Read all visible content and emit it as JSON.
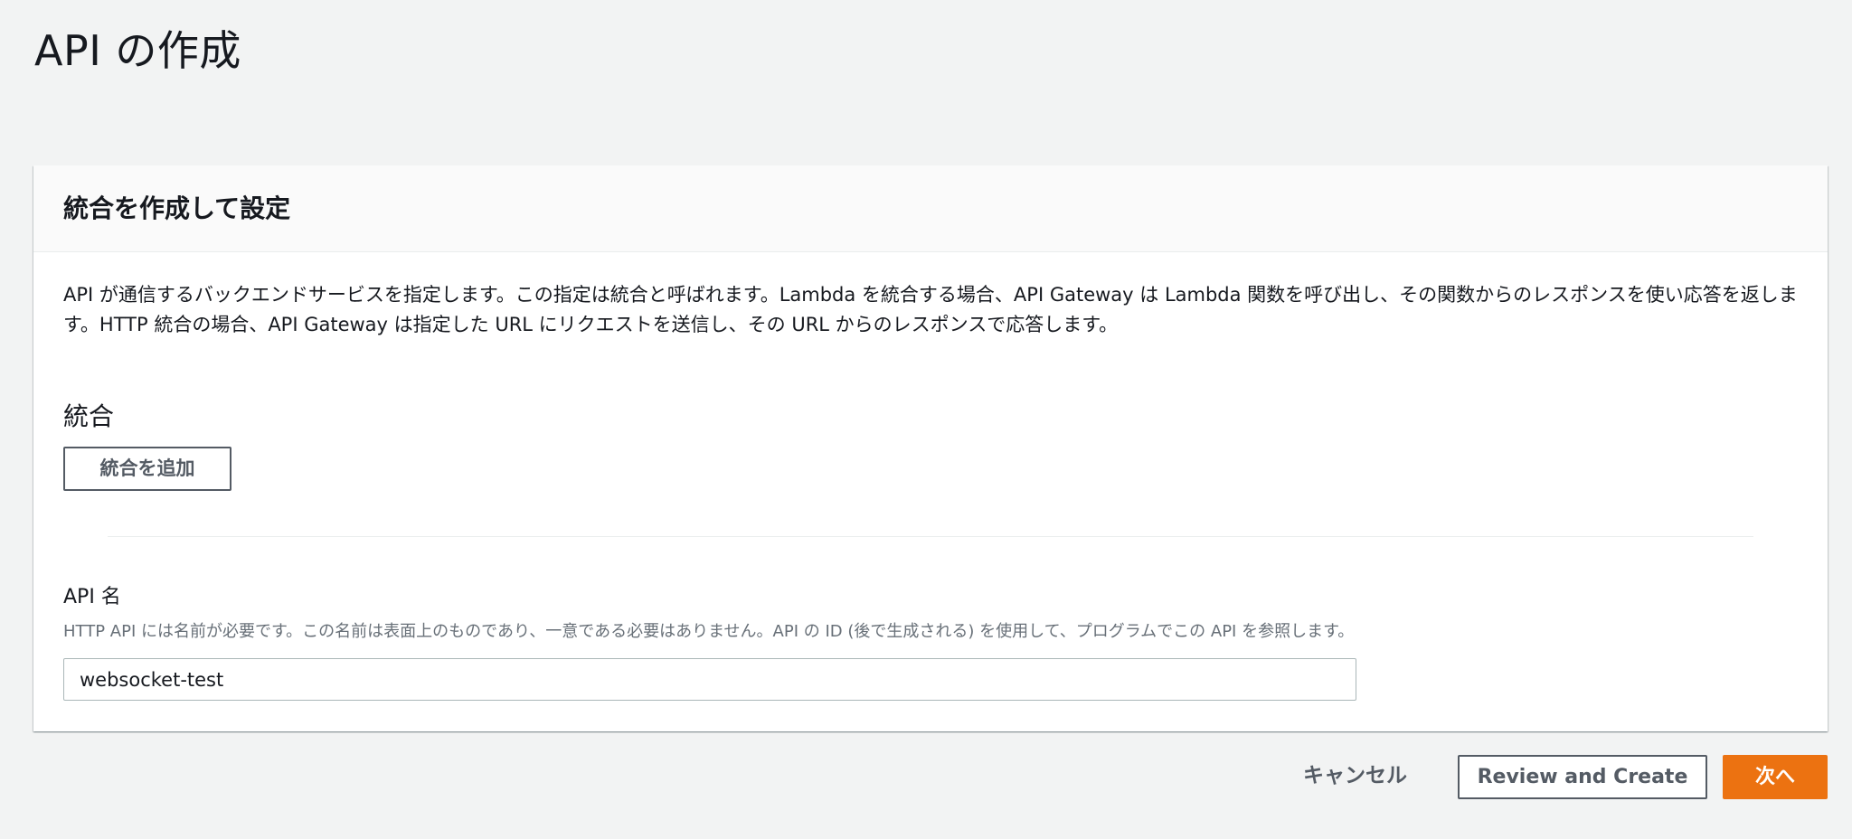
{
  "page": {
    "title": "API の作成"
  },
  "panel": {
    "title": "統合を作成して設定",
    "description": "API が通信するバックエンドサービスを指定します。この指定は統合と呼ばれます。Lambda を統合する場合、API Gateway は Lambda 関数を呼び出し、その関数からのレスポンスを使い応答を返します。HTTP 統合の場合、API Gateway は指定した URL にリクエストを送信し、その URL からのレスポンスで応答します。"
  },
  "integrations": {
    "heading": "統合",
    "add_button_label": "統合を追加"
  },
  "api_name": {
    "label": "API 名",
    "help_text": "HTTP API には名前が必要です。この名前は表面上のものであり、一意である必要はありません。API の ID (後で生成される) を使用して、プログラムでこの API を参照します。",
    "value": "websocket-test"
  },
  "footer": {
    "cancel_label": "キャンセル",
    "review_create_label": "Review and Create",
    "next_label": "次へ"
  },
  "colors": {
    "primary_button": "#ec7211",
    "page_background": "#f2f3f3"
  }
}
